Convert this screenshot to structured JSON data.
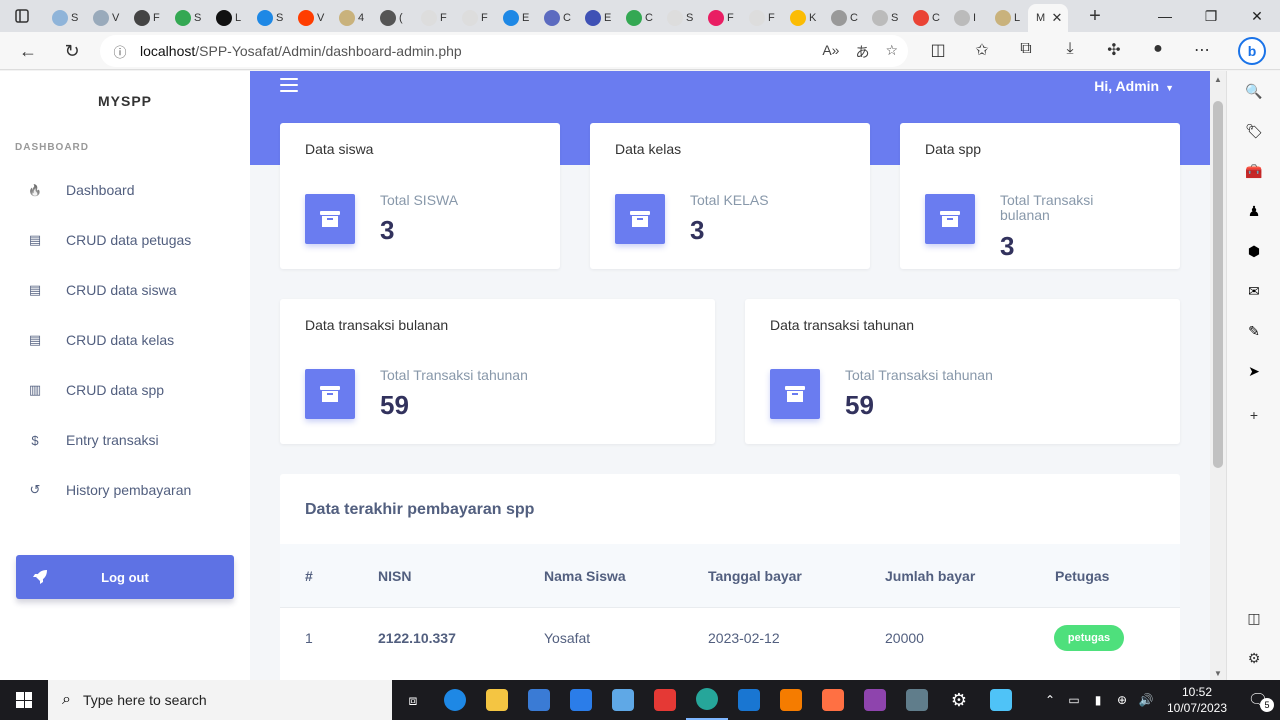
{
  "browser": {
    "tabs": [
      {
        "title": "S",
        "color": "#8fb4d9"
      },
      {
        "title": "V",
        "color": "#9ab"
      },
      {
        "title": "F",
        "color": "#444"
      },
      {
        "title": "S",
        "color": "#34a853"
      },
      {
        "title": "L",
        "color": "#111"
      },
      {
        "title": "S",
        "color": "#1e88e5"
      },
      {
        "title": "V",
        "color": "#ff3d00"
      },
      {
        "title": "4",
        "color": "#c9b27c"
      },
      {
        "title": "(",
        "color": "#555"
      },
      {
        "title": "F",
        "color": "#ddd"
      },
      {
        "title": "F",
        "color": "#ddd"
      },
      {
        "title": "E",
        "color": "#1e88e5"
      },
      {
        "title": "C",
        "color": "#5c6bc0"
      },
      {
        "title": "E",
        "color": "#3f51b5"
      },
      {
        "title": "C",
        "color": "#34a853"
      },
      {
        "title": "S",
        "color": "#ddd"
      },
      {
        "title": "F",
        "color": "#e91e63"
      },
      {
        "title": "F",
        "color": "#ddd"
      },
      {
        "title": "K",
        "color": "#fbbc04"
      },
      {
        "title": "C",
        "color": "#999"
      },
      {
        "title": "S",
        "color": "#bbb"
      },
      {
        "title": "C",
        "color": "#ea4335"
      },
      {
        "title": "I",
        "color": "#bbb"
      },
      {
        "title": "L",
        "color": "#c9b27c"
      }
    ],
    "active_tab_title": "M",
    "url_host": "localhost",
    "url_path": "/SPP-Yosafat/Admin/dashboard-admin.php"
  },
  "sidebar": {
    "brand": "MYSPP",
    "section_label": "DASHBOARD",
    "items": [
      {
        "label": "Dashboard",
        "icon": "fire-icon"
      },
      {
        "label": "CRUD data petugas",
        "icon": "id-card-icon"
      },
      {
        "label": "CRUD data siswa",
        "icon": "id-card-icon"
      },
      {
        "label": "CRUD data kelas",
        "icon": "id-card-icon"
      },
      {
        "label": "CRUD data spp",
        "icon": "file-icon"
      },
      {
        "label": "Entry transaksi",
        "icon": "dollar-icon"
      },
      {
        "label": "History pembayaran",
        "icon": "history-icon"
      }
    ],
    "logout_label": "Log out"
  },
  "header": {
    "greeting": "Hi, Admin"
  },
  "stats": [
    {
      "title": "Data siswa",
      "label": "Total SISWA",
      "value": "3"
    },
    {
      "title": "Data kelas",
      "label": "Total KELAS",
      "value": "3"
    },
    {
      "title": "Data spp",
      "label": "Total Transaksi bulanan",
      "value": "3"
    },
    {
      "title": "Data transaksi bulanan",
      "label": "Total Transaksi tahunan",
      "value": "59"
    },
    {
      "title": "Data transaksi tahunan",
      "label": "Total Transaksi tahunan",
      "value": "59"
    }
  ],
  "payments": {
    "title": "Data terakhir pembayaran spp",
    "columns": [
      "#",
      "NISN",
      "Nama Siswa",
      "Tanggal bayar",
      "Jumlah bayar",
      "Petugas"
    ],
    "rows": [
      {
        "no": "1",
        "nisn": "2122.10.337",
        "nama": "Yosafat",
        "tanggal": "2023-02-12",
        "jumlah": "20000",
        "petugas": "petugas"
      }
    ]
  },
  "taskbar": {
    "search_placeholder": "Type here to search",
    "time": "10:52",
    "date": "10/07/2023",
    "notification_count": "5"
  },
  "colors": {
    "accent": "#6a7cf0",
    "badge": "#4ee07c"
  }
}
